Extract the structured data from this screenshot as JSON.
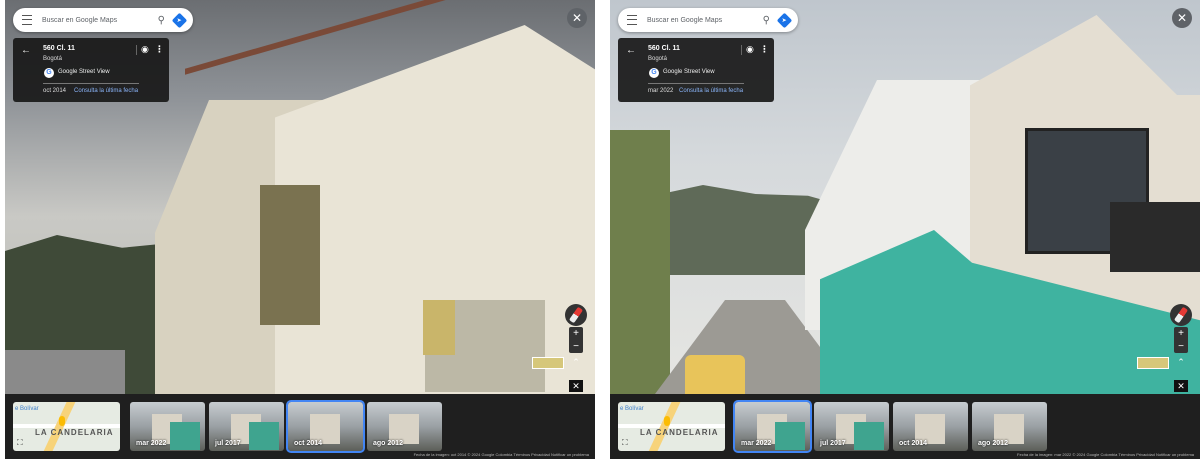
{
  "panels": [
    {
      "search": {
        "placeholder": "Buscar en Google Maps"
      },
      "info": {
        "address": "560 Cl. 11",
        "city": "Bogotá",
        "source": "Google Street View",
        "date": "oct 2014",
        "latest_link": "Consulta la última fecha"
      },
      "map": {
        "area_label": "LA CANDELARIA",
        "poi": "e Bolívar"
      },
      "thumbnails": [
        {
          "label": "mar 2022",
          "selected": false
        },
        {
          "label": "jul 2017",
          "selected": false
        },
        {
          "label": "oct 2014",
          "selected": true
        },
        {
          "label": "ago 2012",
          "selected": false
        }
      ],
      "footer": "Fecha de la imagen: oct 2014   © 2024 Google   Colombia   Términos   Privacidad   Notificar un problema"
    },
    {
      "search": {
        "placeholder": "Buscar en Google Maps"
      },
      "info": {
        "address": "560 Cl. 11",
        "city": "Bogotá",
        "source": "Google Street View",
        "date": "mar 2022",
        "latest_link": "Consulta la última fecha"
      },
      "map": {
        "area_label": "LA CANDELARIA",
        "poi": "e Bolívar"
      },
      "thumbnails": [
        {
          "label": "mar 2022",
          "selected": true
        },
        {
          "label": "jul 2017",
          "selected": false
        },
        {
          "label": "oct 2014",
          "selected": false
        },
        {
          "label": "ago 2012",
          "selected": false
        }
      ],
      "footer": "Fecha de la imagen: mar 2022   © 2024 Google   Colombia   Términos   Privacidad   Notificar un problema"
    }
  ],
  "icons": {
    "menu": "menu-icon",
    "search": "search-icon",
    "directions": "directions-icon",
    "back": "back-arrow-icon",
    "pin": "pin-icon",
    "more": "more-vert-icon",
    "close": "close-icon",
    "compass": "compass-icon"
  },
  "colors": {
    "accent": "#1a73e8",
    "card": "#181818",
    "link": "#8ab4f8",
    "selected_outline": "#4285f4"
  }
}
